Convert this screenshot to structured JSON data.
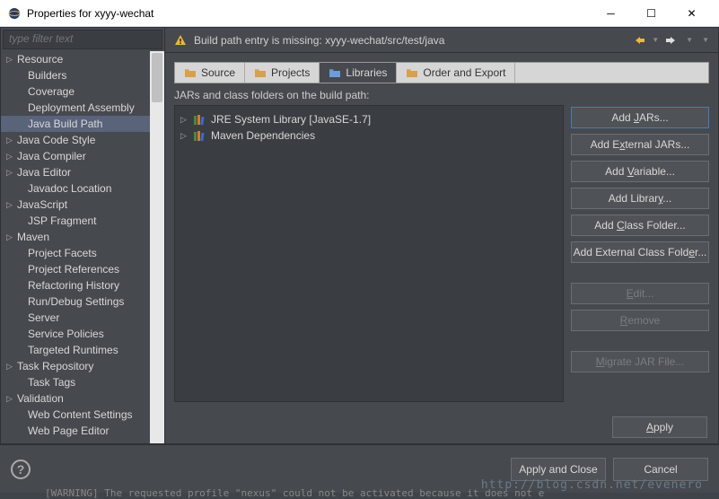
{
  "window": {
    "title": "Properties for xyyy-wechat"
  },
  "filter": {
    "placeholder": "type filter text"
  },
  "sidebar": {
    "items": [
      {
        "label": "Resource",
        "expandable": true,
        "indent": false
      },
      {
        "label": "Builders",
        "expandable": false,
        "indent": true
      },
      {
        "label": "Coverage",
        "expandable": false,
        "indent": true
      },
      {
        "label": "Deployment Assembly",
        "expandable": false,
        "indent": true
      },
      {
        "label": "Java Build Path",
        "expandable": false,
        "indent": true,
        "selected": true
      },
      {
        "label": "Java Code Style",
        "expandable": true,
        "indent": false
      },
      {
        "label": "Java Compiler",
        "expandable": true,
        "indent": false
      },
      {
        "label": "Java Editor",
        "expandable": true,
        "indent": false
      },
      {
        "label": "Javadoc Location",
        "expandable": false,
        "indent": true
      },
      {
        "label": "JavaScript",
        "expandable": true,
        "indent": false
      },
      {
        "label": "JSP Fragment",
        "expandable": false,
        "indent": true
      },
      {
        "label": "Maven",
        "expandable": true,
        "indent": false
      },
      {
        "label": "Project Facets",
        "expandable": false,
        "indent": true
      },
      {
        "label": "Project References",
        "expandable": false,
        "indent": true
      },
      {
        "label": "Refactoring History",
        "expandable": false,
        "indent": true
      },
      {
        "label": "Run/Debug Settings",
        "expandable": false,
        "indent": true
      },
      {
        "label": "Server",
        "expandable": false,
        "indent": true
      },
      {
        "label": "Service Policies",
        "expandable": false,
        "indent": true
      },
      {
        "label": "Targeted Runtimes",
        "expandable": false,
        "indent": true
      },
      {
        "label": "Task Repository",
        "expandable": true,
        "indent": false
      },
      {
        "label": "Task Tags",
        "expandable": false,
        "indent": true
      },
      {
        "label": "Validation",
        "expandable": true,
        "indent": false
      },
      {
        "label": "Web Content Settings",
        "expandable": false,
        "indent": true
      },
      {
        "label": "Web Page Editor",
        "expandable": false,
        "indent": true
      }
    ]
  },
  "warning": {
    "text": "Build path entry is missing: xyyy-wechat/src/test/java"
  },
  "tabs": [
    {
      "label": "Source",
      "iconColor": "#d9a04a"
    },
    {
      "label": "Projects",
      "iconColor": "#d9a04a"
    },
    {
      "label": "Libraries",
      "iconColor": "#6a9ed9",
      "active": true
    },
    {
      "label": "Order and Export",
      "iconColor": "#d9a04a"
    }
  ],
  "jarSection": {
    "label": "JARs and class folders on the build path:",
    "items": [
      {
        "label": "JRE System Library [JavaSE-1.7]"
      },
      {
        "label": "Maven Dependencies"
      }
    ]
  },
  "buttons": {
    "addJars": "Add JARs...",
    "addExternalJars": "Add External JARs...",
    "addVariable": "Add Variable...",
    "addLibrary": "Add Library...",
    "addClassFolder": "Add Class Folder...",
    "addExternalClassFolder": "Add External Class Folder...",
    "edit": "Edit...",
    "remove": "Remove",
    "migrate": "Migrate JAR File...",
    "apply": "Apply",
    "applyClose": "Apply and Close",
    "cancel": "Cancel"
  },
  "watermark": "http://blog.csdn.net/evenero",
  "terminal": "[WARNING] The requested profile \"nexus\" could not be activated because it does not e"
}
